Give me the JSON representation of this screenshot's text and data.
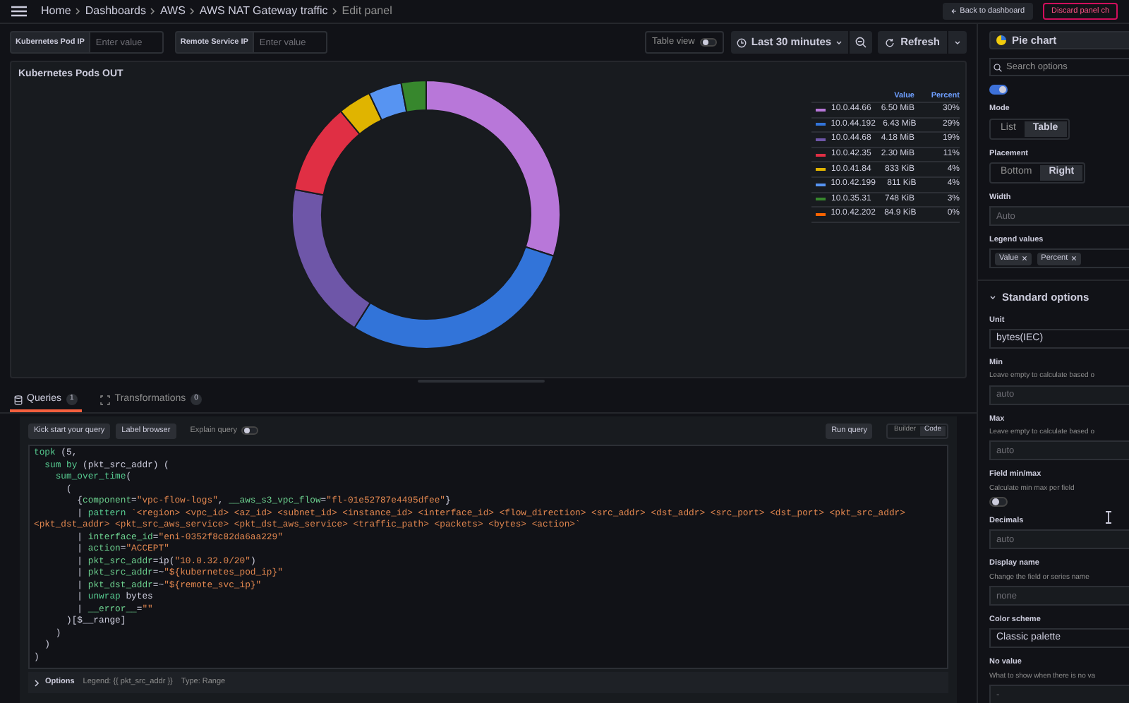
{
  "top_bar": {
    "breadcrumbs": [
      "Home",
      "Dashboards",
      "AWS",
      "AWS NAT Gateway traffic",
      "Edit panel"
    ],
    "buttons": [
      {
        "label": "Back to dashboard",
        "kind": "secondary"
      },
      {
        "label": "Discard panel ch",
        "kind": "destructive"
      }
    ]
  },
  "variables": [
    {
      "label": "Kubernetes Pod IP",
      "placeholder": "Enter value"
    },
    {
      "label": "Remote Service IP",
      "placeholder": "Enter value"
    }
  ],
  "toolbar": {
    "table_view": {
      "label": "Table view",
      "on": false
    },
    "time_range": "Last 30 minutes",
    "refresh": "Refresh"
  },
  "panel": {
    "title": "Kubernetes Pods OUT",
    "chart_data": {
      "type": "donut",
      "values": [
        30,
        29,
        19,
        11,
        4,
        4,
        3,
        0
      ]
    },
    "legend": {
      "columns": [
        "Value",
        "Percent"
      ],
      "rows": [
        {
          "name": "10.0.44.66",
          "value": "6.50 MiB",
          "percent": "30%",
          "color": "#b877d9"
        },
        {
          "name": "10.0.44.192",
          "value": "6.43 MiB",
          "percent": "29%",
          "color": "#3274d9"
        },
        {
          "name": "10.0.44.68",
          "value": "4.18 MiB",
          "percent": "19%",
          "color": "#6e56a8"
        },
        {
          "name": "10.0.42.35",
          "value": "2.30 MiB",
          "percent": "11%",
          "color": "#e02f44"
        },
        {
          "name": "10.0.41.84",
          "value": "833 KiB",
          "percent": "4%",
          "color": "#e0b400"
        },
        {
          "name": "10.0.42.199",
          "value": "811 KiB",
          "percent": "4%",
          "color": "#5794f2"
        },
        {
          "name": "10.0.35.31",
          "value": "748 KiB",
          "percent": "3%",
          "color": "#37872d"
        },
        {
          "name": "10.0.42.202",
          "value": "84.9 KiB",
          "percent": "0%",
          "color": "#fa6400"
        }
      ]
    }
  },
  "query_tabs": [
    {
      "label": "Queries",
      "count": "1",
      "selected": true
    },
    {
      "label": "Transformations",
      "count": "0",
      "selected": false
    }
  ],
  "query_toolbar": {
    "buttons": [
      "Kick start your query",
      "Label browser"
    ],
    "explain": {
      "label": "Explain query",
      "on": false
    },
    "run": "Run query",
    "modes": [
      {
        "label": "Builder",
        "selected": false
      },
      {
        "label": "Code",
        "selected": true
      }
    ]
  },
  "code": [
    [
      {
        "text": "topk",
        "kind": "function"
      },
      {
        "text": " (5,",
        "kind": "plain"
      }
    ],
    [
      {
        "text": "  sum by",
        "kind": "function"
      },
      {
        "text": " (pkt_src_addr) (",
        "kind": "plain"
      }
    ],
    [
      {
        "text": "    sum_over_time",
        "kind": "function"
      },
      {
        "text": "(",
        "kind": "plain"
      }
    ],
    [
      {
        "text": "      (",
        "kind": "plain"
      }
    ],
    [
      {
        "text": "        {",
        "kind": "plain"
      },
      {
        "text": "component",
        "kind": "label"
      },
      {
        "text": "=",
        "kind": "plain"
      },
      {
        "text": "\"vpc-flow-logs\"",
        "kind": "string"
      },
      {
        "text": ", ",
        "kind": "plain"
      },
      {
        "text": "__aws_s3_vpc_flow",
        "kind": "label"
      },
      {
        "text": "=",
        "kind": "plain"
      },
      {
        "text": "\"fl-01e52787e4495dfee\"",
        "kind": "string"
      },
      {
        "text": "}",
        "kind": "plain"
      }
    ],
    [
      {
        "text": "        | ",
        "kind": "plain"
      },
      {
        "text": "pattern",
        "kind": "function"
      },
      {
        "text": " `<region> <vpc_id> <az_id> <subnet_id> <instance_id> <interface_id> <flow_direction> <src_addr> <dst_addr> <src_port> <dst_port> <pkt_src_addr>",
        "kind": "string"
      }
    ],
    [
      {
        "text": "<pkt_dst_addr> <pkt_src_aws_service> <pkt_dst_aws_service> <traffic_path> <packets> <bytes> <action>`",
        "kind": "string"
      }
    ],
    [
      {
        "text": "        | ",
        "kind": "plain"
      },
      {
        "text": "interface_id",
        "kind": "label"
      },
      {
        "text": "=",
        "kind": "plain"
      },
      {
        "text": "\"eni-0352f8c82da6aa229\"",
        "kind": "string"
      }
    ],
    [
      {
        "text": "        | ",
        "kind": "plain"
      },
      {
        "text": "action",
        "kind": "label"
      },
      {
        "text": "=",
        "kind": "plain"
      },
      {
        "text": "\"ACCEPT\"",
        "kind": "string"
      }
    ],
    [
      {
        "text": "        | ",
        "kind": "plain"
      },
      {
        "text": "pkt_src_addr",
        "kind": "label"
      },
      {
        "text": "=ip(",
        "kind": "plain"
      },
      {
        "text": "\"10.0.32.0/20\"",
        "kind": "string"
      },
      {
        "text": ")",
        "kind": "plain"
      }
    ],
    [
      {
        "text": "        | ",
        "kind": "plain"
      },
      {
        "text": "pkt_src_addr",
        "kind": "label"
      },
      {
        "text": "=~",
        "kind": "plain"
      },
      {
        "text": "\"${kubernetes_pod_ip}\"",
        "kind": "string"
      }
    ],
    [
      {
        "text": "        | ",
        "kind": "plain"
      },
      {
        "text": "pkt_dst_addr",
        "kind": "label"
      },
      {
        "text": "=~",
        "kind": "plain"
      },
      {
        "text": "\"${remote_svc_ip}\"",
        "kind": "string"
      }
    ],
    [
      {
        "text": "        | ",
        "kind": "plain"
      },
      {
        "text": "unwrap",
        "kind": "function"
      },
      {
        "text": " bytes",
        "kind": "plain"
      }
    ],
    [
      {
        "text": "        | ",
        "kind": "plain"
      },
      {
        "text": "__error__",
        "kind": "label"
      },
      {
        "text": "=",
        "kind": "plain"
      },
      {
        "text": "\"\"",
        "kind": "string"
      }
    ],
    [
      {
        "text": "      )[$__range]",
        "kind": "plain"
      }
    ],
    [
      {
        "text": "    )",
        "kind": "plain"
      }
    ],
    [
      {
        "text": "  )",
        "kind": "plain"
      }
    ],
    [
      {
        "text": ")",
        "kind": "plain"
      }
    ]
  ],
  "query_options": {
    "label": "Options",
    "legend": "Legend: {{ pkt_src_addr }}",
    "type": "Type: Range"
  },
  "options_pane": {
    "visualization": "Pie chart",
    "search_placeholder": "Search options",
    "items": [
      {
        "kind": "toggle",
        "on": true
      },
      {
        "kind": "segmented",
        "label": "Mode",
        "options": [
          {
            "label": "List",
            "selected": false
          },
          {
            "label": "Table",
            "selected": true
          }
        ]
      },
      {
        "kind": "segmented",
        "label": "Placement",
        "options": [
          {
            "label": "Bottom",
            "selected": false
          },
          {
            "label": "Right",
            "selected": true
          }
        ]
      },
      {
        "kind": "input",
        "label": "Width",
        "placeholder": "Auto"
      },
      {
        "kind": "chips",
        "label": "Legend values",
        "chips": [
          "Value",
          "Percent"
        ]
      },
      {
        "kind": "section",
        "label": "Standard options",
        "expanded": true
      },
      {
        "kind": "input",
        "label": "Unit",
        "value": "bytes(IEC)"
      },
      {
        "kind": "input",
        "label": "Min",
        "description": "Leave empty to calculate based o",
        "placeholder": "auto"
      },
      {
        "kind": "input",
        "label": "Max",
        "description": "Leave empty to calculate based o",
        "placeholder": "auto"
      },
      {
        "kind": "toggle",
        "label": "Field min/max",
        "description": "Calculate min max per field",
        "on": false
      },
      {
        "kind": "input",
        "label": "Decimals",
        "placeholder": "auto"
      },
      {
        "kind": "input",
        "label": "Display name",
        "description": "Change the field or series name",
        "placeholder": "none"
      },
      {
        "kind": "input",
        "label": "Color scheme",
        "value": "Classic palette"
      },
      {
        "kind": "input",
        "label": "No value",
        "description": "What to show when there is no va",
        "placeholder": "-"
      }
    ]
  }
}
